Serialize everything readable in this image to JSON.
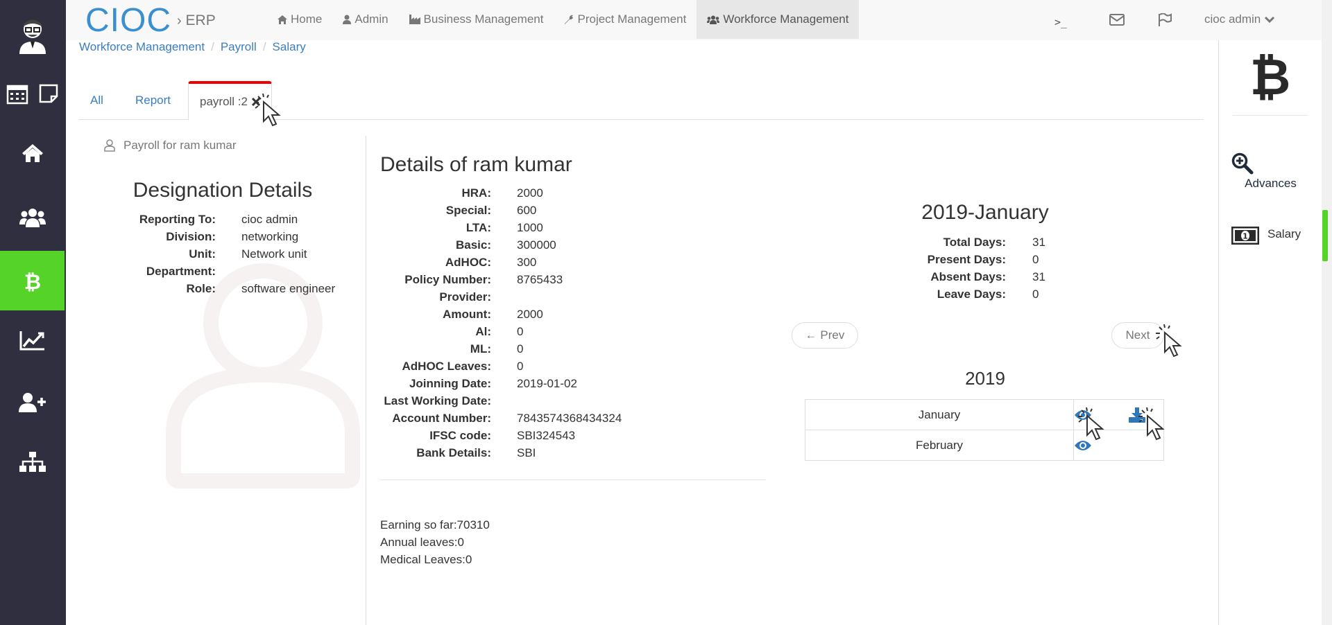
{
  "brand": {
    "name": "CIOC",
    "sub": "ERP"
  },
  "nav": {
    "items": [
      {
        "label": "Home",
        "icon": "home-icon"
      },
      {
        "label": "Admin",
        "icon": "user-icon"
      },
      {
        "label": "Business Management",
        "icon": "industry-icon"
      },
      {
        "label": "Project Management",
        "icon": "wrench-icon"
      },
      {
        "label": "Workforce Management",
        "icon": "users-icon",
        "active": true
      }
    ],
    "terminal": ">_",
    "user": "cioc admin"
  },
  "breadcrumb": [
    "Workforce Management",
    "Payroll",
    "Salary"
  ],
  "tabs": {
    "all": "All",
    "report": "Report",
    "payroll": "payroll :2"
  },
  "left": {
    "header": "Payroll for ram kumar",
    "title": "Designation Details",
    "rows": [
      {
        "k": "Reporting To:",
        "v": "cioc admin"
      },
      {
        "k": "Division:",
        "v": "networking"
      },
      {
        "k": "Unit:",
        "v": "Network unit"
      },
      {
        "k": "Department:",
        "v": ""
      },
      {
        "k": "Role:",
        "v": "software engineer"
      }
    ]
  },
  "details": {
    "title": "Details of ram kumar",
    "rows": [
      {
        "k": "HRA:",
        "v": "2000"
      },
      {
        "k": "Special:",
        "v": "600"
      },
      {
        "k": "LTA:",
        "v": "1000"
      },
      {
        "k": "Basic:",
        "v": "300000"
      },
      {
        "k": "AdHOC:",
        "v": "300"
      },
      {
        "k": "Policy Number:",
        "v": "8765433"
      },
      {
        "k": "Provider:",
        "v": ""
      },
      {
        "k": "Amount:",
        "v": "2000"
      },
      {
        "k": "Al:",
        "v": "0"
      },
      {
        "k": "ML:",
        "v": "0"
      },
      {
        "k": "AdHOC Leaves:",
        "v": "0"
      },
      {
        "k": "Joinning Date:",
        "v": "2019-01-02"
      },
      {
        "k": "Last Working Date:",
        "v": ""
      },
      {
        "k": "Account Number:",
        "v": "7843574368434324"
      },
      {
        "k": "IFSC code:",
        "v": "SBI324543"
      },
      {
        "k": "Bank Details:",
        "v": "SBI"
      }
    ],
    "summary": [
      "Earning so far:70310",
      "Annual leaves:0",
      "Medical Leaves:0"
    ]
  },
  "month": {
    "title": "2019-January",
    "rows": [
      {
        "k": "Total Days:",
        "v": "31"
      },
      {
        "k": "Present Days:",
        "v": "0"
      },
      {
        "k": "Absent Days:",
        "v": "31"
      },
      {
        "k": "Leave Days:",
        "v": "0"
      }
    ],
    "prev": "← Prev",
    "next": "Next"
  },
  "year": {
    "title": "2019",
    "months": [
      {
        "name": "January",
        "view": true,
        "download": true
      },
      {
        "name": "February",
        "view": true,
        "download": false
      }
    ]
  },
  "right": {
    "advances": "Advances",
    "salary": "Salary"
  },
  "colors": {
    "accent": "#56d328",
    "sidebar": "#2f2f3f",
    "link": "#3a7dc0",
    "brand": "#3a8fd0",
    "tabTop": "#e00000"
  }
}
